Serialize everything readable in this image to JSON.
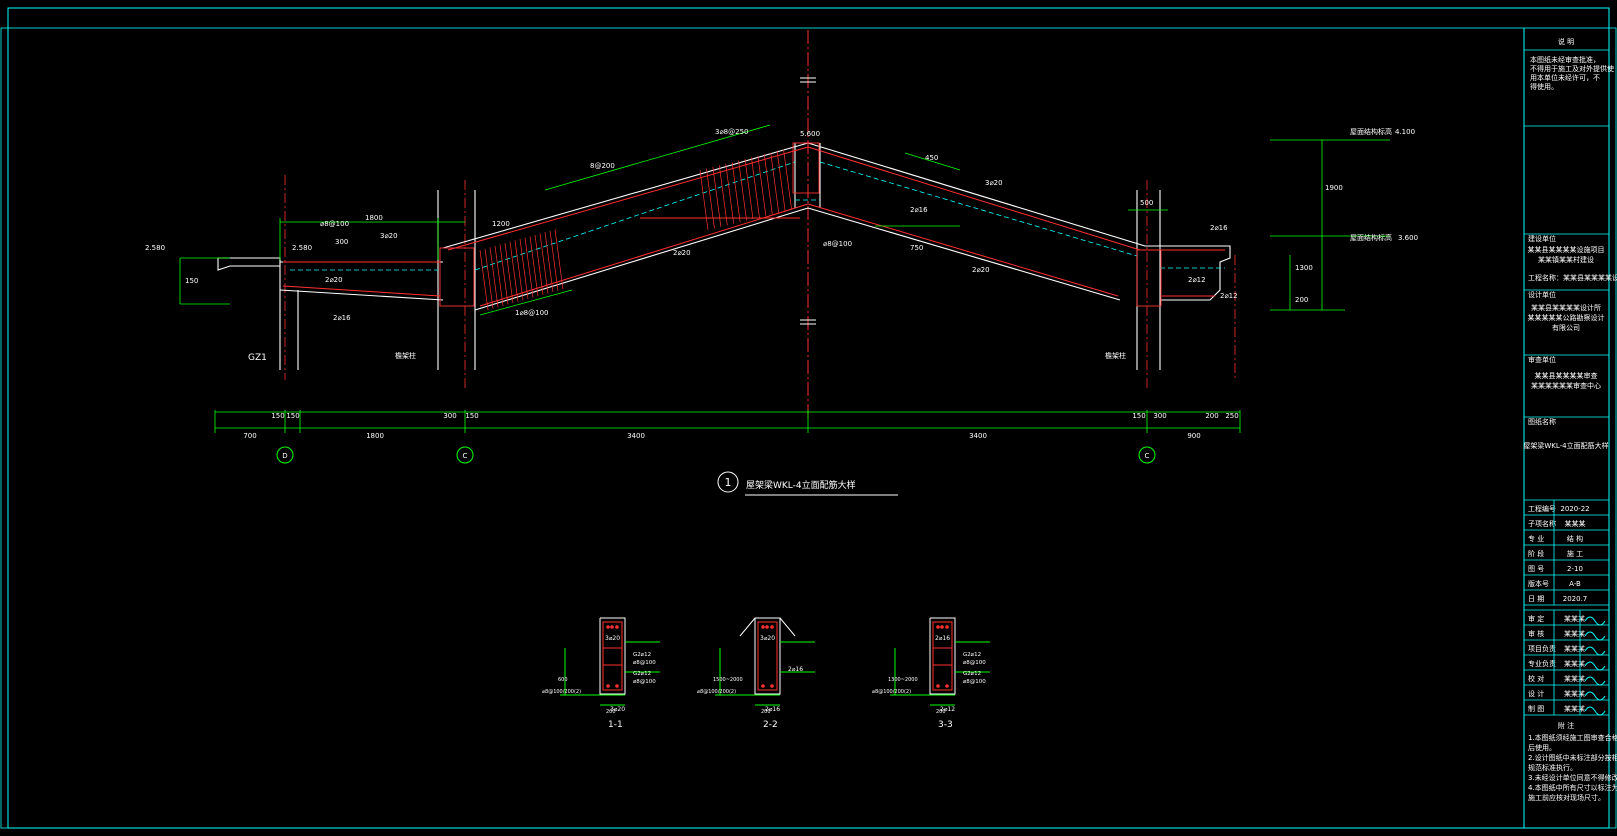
{
  "drawing": {
    "title": "屋架梁WKL-4立面配筋大样",
    "detail_number": "1",
    "axis_labels": [
      "D",
      "C",
      "C"
    ],
    "bottom_dimensions": [
      "700",
      "1800",
      "3400",
      "3400",
      "900"
    ],
    "sub_dimensions": [
      "150",
      "150",
      "300",
      "150",
      "150",
      "300",
      "200",
      "250"
    ],
    "left_elevation": "2.580",
    "left_elevation_2": "2.580",
    "top_elevation": "5.600",
    "right_elevation_top": "4.100",
    "right_elevation_bottom": "3.600",
    "right_label_top": "屋面结构标高",
    "right_label_bottom": "屋面结构标高",
    "column_left": "GZ1",
    "column_mid": "檐架柱",
    "column_right": "檐架柱",
    "rebar_labels": {
      "a": "8@200",
      "b": "3⌀20",
      "c": "2⌀16",
      "d": "⌀8@100",
      "e": "2⌀20",
      "f": "3⌀20",
      "g": "2⌀16",
      "h": "2⌀12",
      "i": "3⌀8@250",
      "j": "2⌀20",
      "k": "1⌀8@100",
      "l": "2⌀16",
      "m": "G2⌀12"
    },
    "dims_misc": [
      "1800",
      "1200",
      "300",
      "450",
      "750",
      "500",
      "1900",
      "1300",
      "200",
      "500",
      "150"
    ]
  },
  "sections": [
    {
      "label": "1-1",
      "top": "3⌀20",
      "mid1": "G2⌀12",
      "mid2": "⌀8@100",
      "mid3": "G2⌀12",
      "mid4": "⌀8@100",
      "bottom": "3⌀20",
      "left": "⌀8@100/200(2)",
      "height": "600",
      "width": "200"
    },
    {
      "label": "2-2",
      "top": "3⌀20",
      "mid": "2⌀16",
      "bottom": "2⌀16",
      "left": "⌀8@100/200(2)",
      "height": "1500~2000",
      "width": "200"
    },
    {
      "label": "3-3",
      "top": "2⌀16",
      "mid1": "G2⌀12",
      "mid2": "⌀8@100",
      "mid3": "G2⌀12",
      "mid4": "⌀8@100",
      "bottom": "2⌀12",
      "left": "⌀8@100/200(2)",
      "height": "1300~2000",
      "width": "200"
    }
  ],
  "title_block": {
    "header": "说  明",
    "notes": [
      "本图纸未经审查批准，",
      "不得用于施工及对外提供使",
      "用本单位未经许可，不",
      "得使用。"
    ],
    "project_label": "建设单位",
    "project": [
      "某某县某某某某设施项目",
      "某某镇某某村建设"
    ],
    "project_sub": "工程名称：某某县某某某某设施",
    "design_label": "设计单位",
    "design": [
      "某某县某某某某设计所",
      "某某某某某公路勘察设计",
      "有限公司"
    ],
    "review_label": "审查单位",
    "review": [
      "某某县某某某某审查",
      "某某某某某某审查中心"
    ],
    "drawing_label": "图纸名称",
    "drawing_name": "屋架梁WKL-4立面配筋大样",
    "info_rows": [
      {
        "k": "工程编号",
        "v": "2020-22"
      },
      {
        "k": "子项名称",
        "v": "某某某"
      },
      {
        "k": "专  业",
        "v": "结  构"
      },
      {
        "k": "阶  段",
        "v": "施  工"
      },
      {
        "k": "图  号",
        "v": "2-10"
      },
      {
        "k": "版本号",
        "v": "A-B"
      },
      {
        "k": "日  期",
        "v": "2020.7"
      }
    ],
    "sign_rows": [
      {
        "role": "审  定",
        "name": "某某某"
      },
      {
        "role": "审  核",
        "name": "某某某"
      },
      {
        "role": "项目负责",
        "name": "某某某"
      },
      {
        "role": "专业负责",
        "name": "某某某"
      },
      {
        "role": "校  对",
        "name": "某某某"
      },
      {
        "role": "设  计",
        "name": "某某某"
      },
      {
        "role": "制  图",
        "name": "某某某"
      }
    ],
    "footer_header": "附  注",
    "footer_notes": [
      "1.本图纸须经施工图审查合格",
      "后使用。",
      "2.设计图纸中未标注部分按相关",
      "规范标准执行。",
      "3.未经设计单位同意不得修改。",
      "4.本图纸中所有尺寸以标注为准，",
      "施工前应核对现场尺寸。"
    ]
  },
  "colors": {
    "frame": "#00ffff",
    "concrete": "#ffffff",
    "rebar": "#ff3030",
    "dim": "#00ff00",
    "hatch": "#ff3030",
    "axis": "#ff3030",
    "stirrup": "#00ffff"
  }
}
